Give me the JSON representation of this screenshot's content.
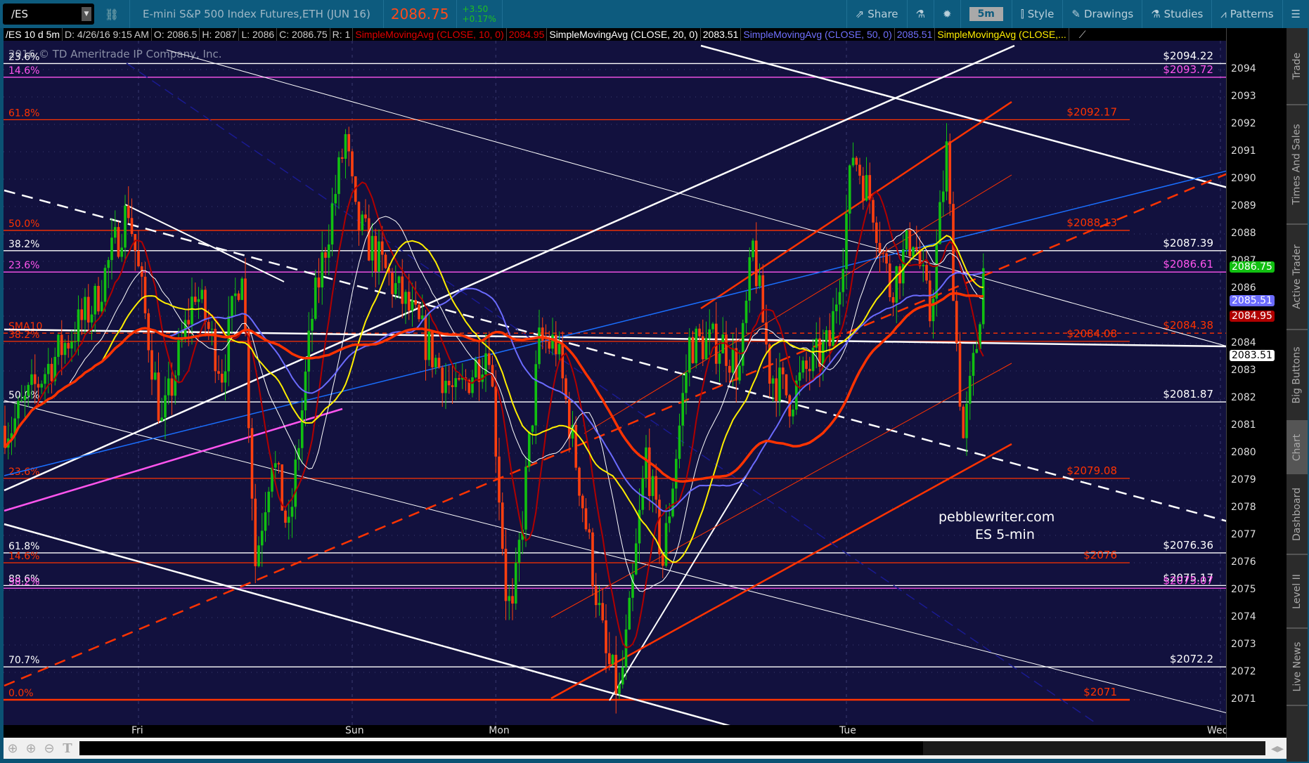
{
  "header": {
    "symbol": "/ES",
    "description": "E-mini S&P 500 Index Futures,ETH (JUN 16)",
    "last": "2086.75",
    "change": "+3.50",
    "change_pct": "+0.17%",
    "share": "Share",
    "timeframe": "5m",
    "style": "Style",
    "drawings": "Drawings",
    "studies": "Studies",
    "patterns": "Patterns"
  },
  "info": {
    "chart": "/ES 10 d 5m",
    "date": "D: 4/26/16 9:15 AM",
    "open": "O: 2086.5",
    "high": "H: 2087",
    "low": "L: 2086",
    "close": "C: 2086.75",
    "range": "R: 1",
    "sma10": "SimpleMovingAvg (CLOSE, 10, 0)",
    "sma10_val": "2084.95",
    "sma20": "SimpleMovingAvg (CLOSE, 20, 0)",
    "sma20_val": "2083.51",
    "sma50": "SimpleMovingAvg (CLOSE, 50, 0)",
    "sma50_val": "2085.51",
    "sma_y": "SimpleMovingAvg (CLOSE,..."
  },
  "watermark": "2016 © TD Ameritrade IP Company, Inc.",
  "annotation": {
    "line1": "pebblewriter.com",
    "line2": "ES 5-min"
  },
  "axis": {
    "ticks": [
      2094,
      2093,
      2092,
      2091,
      2090,
      2089,
      2088,
      2087,
      2086,
      2085,
      2084,
      2083,
      2082,
      2081,
      2080,
      2079,
      2078,
      2077,
      2076,
      2075,
      2074,
      2073,
      2072,
      2071
    ],
    "tags": [
      {
        "v": 2086.75,
        "label": "2086.75",
        "color": "#11c011"
      },
      {
        "v": 2085.51,
        "label": "2085.51",
        "color": "#6b6bff"
      },
      {
        "v": 2084.95,
        "label": "2084.95",
        "color": "#b00000"
      },
      {
        "v": 2083.51,
        "label": "2083.51",
        "color": "#ffffff"
      }
    ]
  },
  "days": [
    {
      "label": "Fri",
      "bar": 40
    },
    {
      "label": "Sun",
      "bar": 104
    },
    {
      "label": "Mon",
      "bar": 147
    },
    {
      "label": "Tue",
      "bar": 252
    },
    {
      "label": "Wed",
      "bar": 364
    }
  ],
  "fibs": [
    {
      "price": 2094.22,
      "left": "23.6%",
      "right": "$2094.22",
      "color": "#ffffff",
      "full": true
    },
    {
      "price": 2093.72,
      "left": "14.6%",
      "right": "$2093.72",
      "color": "#ff55ee",
      "full": true
    },
    {
      "price": 2092.17,
      "left": "61.8%",
      "right": "$2092.17",
      "color": "#ff3300",
      "full": false
    },
    {
      "price": 2088.13,
      "left": "50.0%",
      "right": "$2088.13",
      "color": "#ff3300",
      "full": false
    },
    {
      "price": 2087.39,
      "left": "38.2%",
      "right": "$2087.39",
      "color": "#ffffff",
      "full": true
    },
    {
      "price": 2086.61,
      "left": "23.6%",
      "right": "$2086.61",
      "color": "#ff55ee",
      "full": true
    },
    {
      "price": 2084.38,
      "left": "SMA10",
      "right": "$2084.38",
      "color": "#ff3300",
      "full": true,
      "dashed": true
    },
    {
      "price": 2084.08,
      "left": "38.2%",
      "right": "$2084.08",
      "color": "#ff3300",
      "full": false
    },
    {
      "price": 2081.87,
      "left": "50.0%",
      "right": "$2081.87",
      "color": "#ffffff",
      "full": true
    },
    {
      "price": 2079.08,
      "left": "23.6%",
      "right": "$2079.08",
      "color": "#ff3300",
      "full": false
    },
    {
      "price": 2076.36,
      "left": "61.8%",
      "right": "$2076.36",
      "color": "#ffffff",
      "full": true
    },
    {
      "price": 2076,
      "left": "14.6%",
      "right": "$2076",
      "color": "#ff3300",
      "full": false
    },
    {
      "price": 2075.17,
      "left": "88.6%",
      "right": "$2075.17",
      "color": "#ffffff",
      "full": true
    },
    {
      "price": 2075.07,
      "left": "38.2%",
      "right": "$2075.07",
      "color": "#ff55ee",
      "full": true
    },
    {
      "price": 2072.2,
      "left": "70.7%",
      "right": "$2072.2",
      "color": "#ffffff",
      "full": true
    },
    {
      "price": 2071,
      "left": "0.0%",
      "right": "$2071",
      "color": "#ff3300",
      "full": false
    }
  ],
  "chart_data": {
    "type": "candlestick",
    "ylim": [
      2070,
      2095.5
    ],
    "waypoints": [
      [
        2,
        2081
      ],
      [
        12,
        2083
      ],
      [
        27,
        2085.5
      ],
      [
        37,
        2089
      ],
      [
        42,
        2085
      ],
      [
        47,
        2081
      ],
      [
        57,
        2086
      ],
      [
        65,
        2083
      ],
      [
        71,
        2087
      ],
      [
        75,
        2076
      ],
      [
        80,
        2080
      ],
      [
        85,
        2077
      ],
      [
        92,
        2085
      ],
      [
        102,
        2091.5
      ],
      [
        105,
        2088.5
      ],
      [
        112,
        2087
      ],
      [
        122,
        2085
      ],
      [
        135,
        2082
      ],
      [
        145,
        2084
      ],
      [
        150,
        2075
      ],
      [
        152,
        2074
      ],
      [
        160,
        2084
      ],
      [
        165,
        2084
      ],
      [
        172,
        2079
      ],
      [
        180,
        2072.5
      ],
      [
        184,
        2071.2
      ],
      [
        187,
        2074
      ],
      [
        192,
        2080
      ],
      [
        197,
        2076
      ],
      [
        205,
        2084
      ],
      [
        215,
        2084
      ],
      [
        220,
        2083
      ],
      [
        224,
        2087.5
      ],
      [
        229,
        2083
      ],
      [
        235,
        2082
      ],
      [
        240,
        2083
      ],
      [
        247,
        2084
      ],
      [
        251,
        2087.5
      ],
      [
        254,
        2091
      ],
      [
        260,
        2089
      ],
      [
        265,
        2086
      ],
      [
        272,
        2088
      ],
      [
        277,
        2085
      ],
      [
        282,
        2091
      ],
      [
        285,
        2084
      ],
      [
        287,
        2080.5
      ],
      [
        291,
        2084
      ],
      [
        293,
        2086.75
      ]
    ],
    "studies": [
      {
        "name": "SMA10",
        "period": 10,
        "color": "#b00000"
      },
      {
        "name": "SMA20",
        "period": 20,
        "color": "#ffffff"
      },
      {
        "name": "SMA50",
        "period": 50,
        "color": "#6b6bff"
      },
      {
        "name": "SMA-yellow",
        "period": 30,
        "color": "#ffee00"
      },
      {
        "name": "SMA-orange",
        "period": 70,
        "color": "#ff3300"
      }
    ]
  },
  "sidebar": [
    "Trade",
    "Times And Sales",
    "Active Trader",
    "Big Buttons",
    "Chart",
    "Dashboard",
    "Level II",
    "Live News"
  ]
}
